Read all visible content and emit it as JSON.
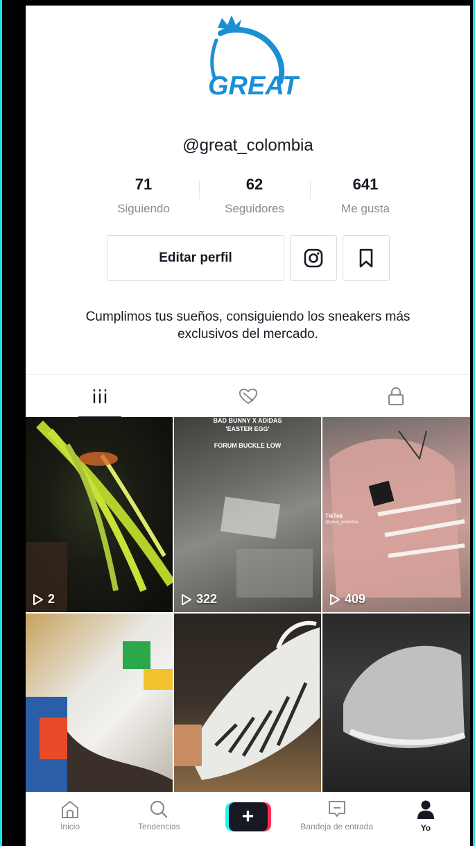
{
  "profile": {
    "logo_text": "GREAT",
    "username": "@great_colombia",
    "bio": "Cumplimos tus sueños, consiguiendo los sneakers más exclusivos del mercado."
  },
  "stats": [
    {
      "value": "71",
      "label": "Siguiendo"
    },
    {
      "value": "62",
      "label": "Seguidores"
    },
    {
      "value": "641",
      "label": "Me gusta"
    }
  ],
  "actions": {
    "edit_label": "Editar perfil",
    "instagram_icon": "instagram-icon",
    "bookmark_icon": "bookmark-icon"
  },
  "tabs": [
    {
      "icon": "videos-grid-icon",
      "active": true
    },
    {
      "icon": "liked-heart-icon",
      "active": false
    },
    {
      "icon": "private-lock-icon",
      "active": false
    }
  ],
  "videos": [
    {
      "views": "2",
      "overlay": ""
    },
    {
      "views": "322",
      "overlay_line1": "BAD BUNNY X ADIDAS",
      "overlay_line2": "'EASTER EGG'",
      "overlay_line3": "FORUM BUCKLE LOW"
    },
    {
      "views": "409",
      "watermark": "TikTok",
      "watermark_user": "@great_colombia"
    },
    {
      "views": ""
    },
    {
      "views": ""
    },
    {
      "views": ""
    }
  ],
  "nav": [
    {
      "label": "Inicio",
      "icon": "home-icon"
    },
    {
      "label": "Tendencias",
      "icon": "search-icon"
    },
    {
      "label": "",
      "icon": "create-plus-icon"
    },
    {
      "label": "Bandeja de entrada",
      "icon": "inbox-icon"
    },
    {
      "label": "Yo",
      "icon": "profile-icon",
      "active": true
    }
  ],
  "colors": {
    "accent_cyan": "#25f4ee",
    "accent_red": "#fe2c55",
    "text_primary": "#161823",
    "text_secondary": "#8a8b91",
    "logo_blue": "#1a8fd6"
  }
}
